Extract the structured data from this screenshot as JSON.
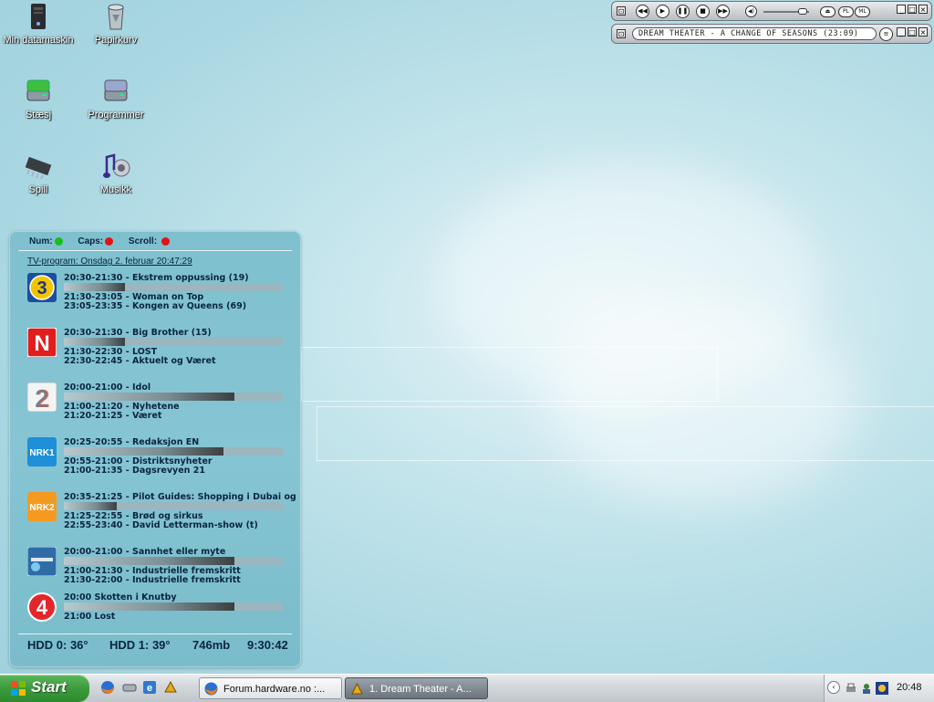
{
  "desktop_icons": [
    {
      "label": "Min datamaskin",
      "icon": "computer-icon"
    },
    {
      "label": "Papirkurv",
      "icon": "recycle-bin-icon"
    },
    {
      "label": "Stæsj",
      "icon": "drive-icon"
    },
    {
      "label": "Programmer",
      "icon": "drive-icon"
    },
    {
      "label": "Spill",
      "icon": "chip-icon"
    },
    {
      "label": "Musikk",
      "icon": "music-icon"
    }
  ],
  "tv_widget": {
    "locks": {
      "num": "Num:",
      "caps": "Caps:",
      "scroll": "Scroll:"
    },
    "lock_states": {
      "num": "on",
      "caps": "off",
      "scroll": "off"
    },
    "title": "TV-program: Onsdag 2. februar 20:47:29",
    "channels": [
      {
        "logo": "tv3-logo",
        "now": "20:30-21:30 - Ekstrem oppussing (19)",
        "progress": 0.28,
        "next1": "21:30-23:05 - Woman on Top",
        "next2": "23:05-23:35 - Kongen av Queens (69)"
      },
      {
        "logo": "tvnorge-logo",
        "now": "20:30-21:30 - Big Brother (15)",
        "progress": 0.28,
        "next1": "21:30-22:30 - LOST",
        "next2": "22:30-22:45 - Aktuelt og Været"
      },
      {
        "logo": "tv2-logo",
        "now": "20:00-21:00 - Idol",
        "progress": 0.78,
        "next1": "21:00-21:20 - Nyhetene",
        "next2": "21:20-21:25 - Været"
      },
      {
        "logo": "nrk1-logo",
        "now": "20:25-20:55 - Redaksjon EN",
        "progress": 0.73,
        "next1": "20:55-21:00 - Distriktsnyheter",
        "next2": "21:00-21:35 - Dagsrevyen 21"
      },
      {
        "logo": "nrk2-logo",
        "now": "20:35-21:25 - Pilot Guides: Shopping i Dubai og",
        "progress": 0.24,
        "next1": "21:25-22:55 - Brød og sirkus",
        "next2": "22:55-23:40 - David Letterman-show (t)"
      },
      {
        "logo": "discovery-logo",
        "now": "20:00-21:00 - Sannhet eller myte",
        "progress": 0.78,
        "next1": "21:00-21:30 - Industrielle fremskritt",
        "next2": "21:30-22:00 - Industrielle fremskritt"
      },
      {
        "logo": "tv4-logo",
        "now": "20:00 Skotten i Knutby",
        "progress": 0.78,
        "next1": "21:00 Lost",
        "next2": ""
      }
    ],
    "status": {
      "hdd0": "HDD 0: 36°",
      "hdd1": "HDD 1: 39°",
      "mem": "746mb",
      "uptime": "9:30:42"
    }
  },
  "winamp": {
    "buttons": [
      "prev",
      "play",
      "pause",
      "stop",
      "next"
    ],
    "pl": "PL",
    "ml": "ML",
    "ticker": "DREAM THEATER - A CHANGE OF SEASONS (23:09)"
  },
  "taskbar": {
    "start": "Start",
    "tasks": [
      {
        "label": "Forum.hardware.no :...",
        "icon": "firefox-icon",
        "active": false
      },
      {
        "label": "1. Dream Theater - A...",
        "icon": "winamp-icon",
        "active": true
      }
    ],
    "clock": "20:48"
  },
  "colors": {
    "taskbar": "#d3d8dc",
    "start": "#3c9a3c",
    "panel": "#86c5d3",
    "text": "#0b2540"
  }
}
